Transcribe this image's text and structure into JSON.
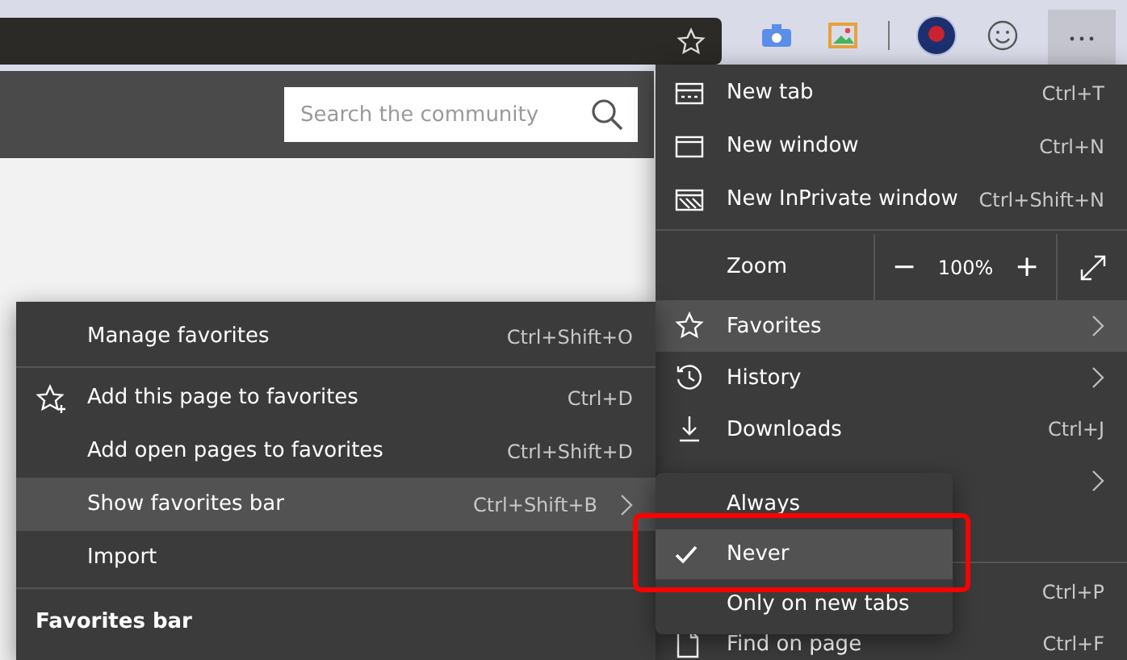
{
  "search": {
    "placeholder": "Search the community"
  },
  "main_menu": {
    "items": [
      {
        "kind": "item",
        "label": "New tab",
        "shortcut": "Ctrl+T",
        "selected": false
      },
      {
        "kind": "item",
        "label": "New window",
        "shortcut": "Ctrl+N",
        "selected": false
      },
      {
        "kind": "item",
        "label": "New InPrivate window",
        "shortcut": "Ctrl+Shift+N",
        "selected": false
      },
      {
        "kind": "separator"
      },
      {
        "kind": "zoom",
        "label": "Zoom",
        "minus": "−",
        "value": "100%",
        "plus": "+"
      },
      {
        "kind": "item",
        "label": "Favorites",
        "submenu": true,
        "selected": true
      },
      {
        "kind": "item",
        "label": "History",
        "submenu": true,
        "selected": false
      },
      {
        "kind": "item",
        "label": "Downloads",
        "shortcut": "Ctrl+J",
        "selected": false
      },
      {
        "kind": "item",
        "submenu": true,
        "selected": false
      },
      {
        "kind": "item",
        "selected": false
      },
      {
        "kind": "separator"
      },
      {
        "kind": "item",
        "shortcut": "Ctrl+P",
        "selected": false
      },
      {
        "kind": "item",
        "label": "Find on page",
        "shortcut": "Ctrl+F",
        "selected": false
      }
    ]
  },
  "favorites_menu": {
    "items": [
      {
        "kind": "item",
        "label": "Manage favorites",
        "shortcut": "Ctrl+Shift+O",
        "selected": false
      },
      {
        "kind": "separator"
      },
      {
        "kind": "item",
        "label": "Add this page to favorites",
        "shortcut": "Ctrl+D",
        "selected": false
      },
      {
        "kind": "item",
        "label": "Add open pages to favorites",
        "shortcut": "Ctrl+Shift+D",
        "selected": false
      },
      {
        "kind": "item",
        "label": "Show favorites bar",
        "shortcut": "Ctrl+Shift+B",
        "submenu": true,
        "selected": true
      },
      {
        "kind": "item",
        "label": "Import",
        "selected": false
      },
      {
        "kind": "separator"
      },
      {
        "kind": "heading",
        "label": "Favorites bar"
      }
    ]
  },
  "favorites_bar_menu": {
    "items": [
      {
        "label": "Always",
        "checked": false,
        "selected": false
      },
      {
        "label": "Never",
        "checked": true,
        "selected": true
      },
      {
        "label": "Only on new tabs",
        "checked": false,
        "selected": false
      }
    ]
  }
}
